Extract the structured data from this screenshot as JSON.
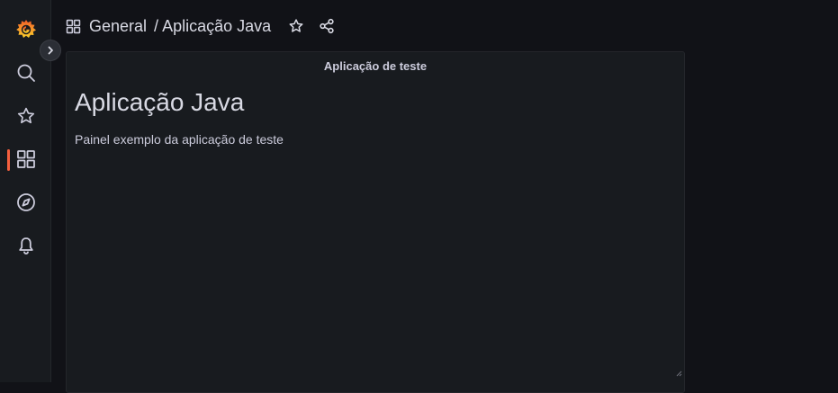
{
  "sidebar": {
    "items": [
      {
        "name": "search",
        "icon": "search-icon"
      },
      {
        "name": "starred",
        "icon": "star-icon"
      },
      {
        "name": "dashboards",
        "icon": "dashboards-icon",
        "active": true
      },
      {
        "name": "explore",
        "icon": "compass-icon"
      },
      {
        "name": "alerting",
        "icon": "bell-icon"
      }
    ],
    "logo": "grafana-logo-icon",
    "expand_icon": "chevron-right-icon"
  },
  "breadcrumb": {
    "folder": "General",
    "separator": "/",
    "dashboard": "Aplicação Java"
  },
  "toolbar": {
    "star_icon": "star-icon",
    "share_icon": "share-icon"
  },
  "panel": {
    "title": "Aplicação de teste",
    "heading": "Aplicação Java",
    "text": "Painel exemplo da aplicação de teste"
  },
  "colors": {
    "background": "#111217",
    "sidebar": "#181b1f",
    "panel": "#181b1f",
    "accent": "#f55f3e",
    "text": "#ccccdc"
  }
}
